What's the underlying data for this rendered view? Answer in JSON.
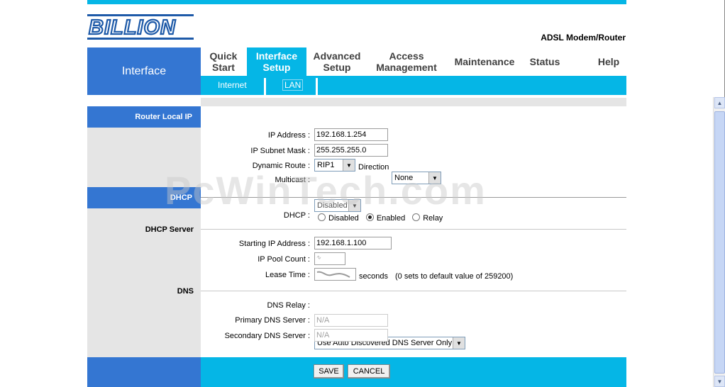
{
  "brand": {
    "logo_text": "BILLION",
    "product": "ADSL Modem/Router"
  },
  "nav": {
    "section_title": "Interface",
    "tabs": [
      {
        "label_line1": "Quick",
        "label_line2": "Start"
      },
      {
        "label_line1": "Interface",
        "label_line2": "Setup"
      },
      {
        "label_line1": "Advanced",
        "label_line2": "Setup"
      },
      {
        "label_line1": "Access",
        "label_line2": "Management"
      },
      {
        "label_line1": "Maintenance",
        "label_line2": ""
      },
      {
        "label_line1": "Status",
        "label_line2": ""
      },
      {
        "label_line1": "Help",
        "label_line2": ""
      }
    ],
    "active_tab": "Interface Setup",
    "subtabs": [
      "Internet",
      "LAN"
    ],
    "active_subtab": "LAN"
  },
  "router_ip": {
    "section_title": "Router Local IP",
    "ip_label": "IP Address :",
    "ip_value": "192.168.1.254",
    "mask_label": "IP Subnet Mask :",
    "mask_value": "255.255.255.0",
    "dynamic_label": "Dynamic Route :",
    "dynamic_value": "RIP1",
    "direction_label": "Direction",
    "direction_value": "None",
    "multicast_label": "Multicast :",
    "multicast_value": "Disabled"
  },
  "dhcp": {
    "section_title": "DHCP",
    "label": "DHCP :",
    "options": [
      "Disabled",
      "Enabled",
      "Relay"
    ],
    "selected": "Enabled",
    "server_title": "DHCP Server",
    "start_label": "Starting IP Address :",
    "start_value": "192.168.1.100",
    "pool_label": "IP Pool Count :",
    "lease_label": "Lease Time :",
    "lease_unit": "seconds",
    "lease_note": "(0 sets to default value of 259200)"
  },
  "dns": {
    "section_title": "DNS",
    "relay_label": "DNS Relay :",
    "relay_value": "Use Auto Discovered DNS Server Only",
    "primary_label": "Primary DNS Server :",
    "primary_value": "N/A",
    "secondary_label": "Secondary DNS Server :",
    "secondary_value": "N/A"
  },
  "buttons": {
    "save": "SAVE",
    "cancel": "CANCEL"
  },
  "watermark": "PcWinTech.com",
  "colors": {
    "cyan": "#05b6e6",
    "blue": "#3476d2",
    "gray": "#e5e5e5"
  }
}
